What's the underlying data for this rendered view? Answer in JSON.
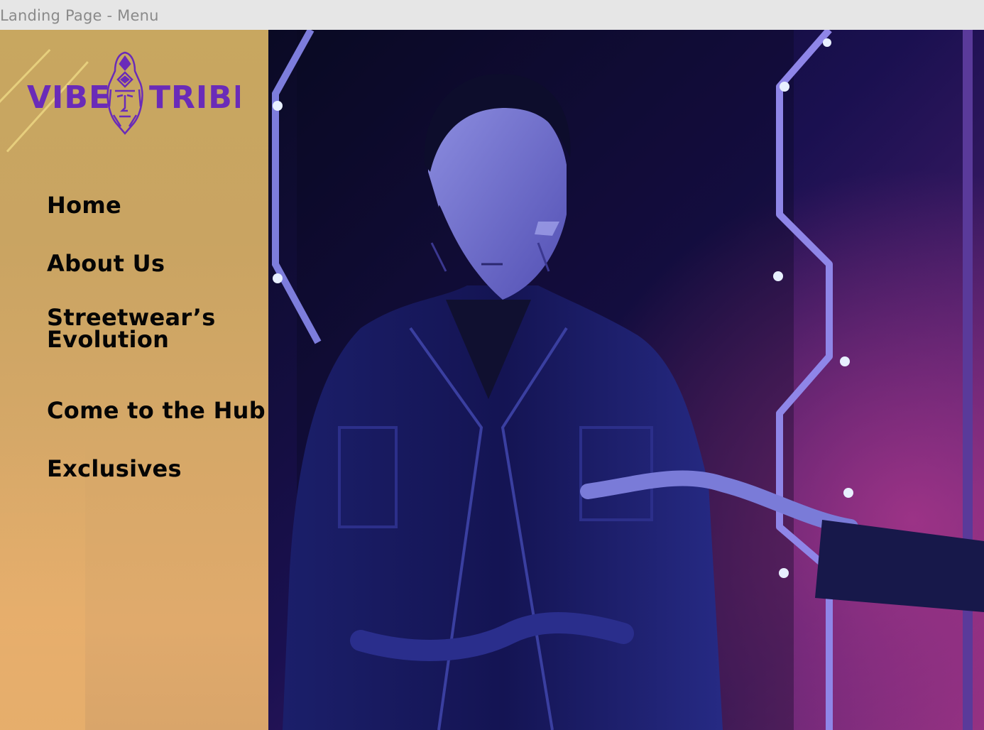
{
  "window": {
    "title": "Landing Page - Menu"
  },
  "brand": {
    "left_word": "VIBE",
    "right_word": "TRIBE",
    "color": "#6a2bb8",
    "icon": "tribal-mask-icon"
  },
  "nav": {
    "items": [
      {
        "label": "Home"
      },
      {
        "label": "About Us"
      },
      {
        "label": "Streetwear’s\nEvolution"
      },
      {
        "label": "Come to the Hub"
      },
      {
        "label": "Exclusives"
      }
    ]
  },
  "colors": {
    "sidebar_bg": "#c8a760",
    "nav_text": "#050505",
    "hero_bg": "#0b0a2a",
    "neon_purple": "#5b2a9c",
    "neon_pink": "#c0308a"
  },
  "hero": {
    "image": "model-in-black-leather-jacket-neon-lights"
  }
}
